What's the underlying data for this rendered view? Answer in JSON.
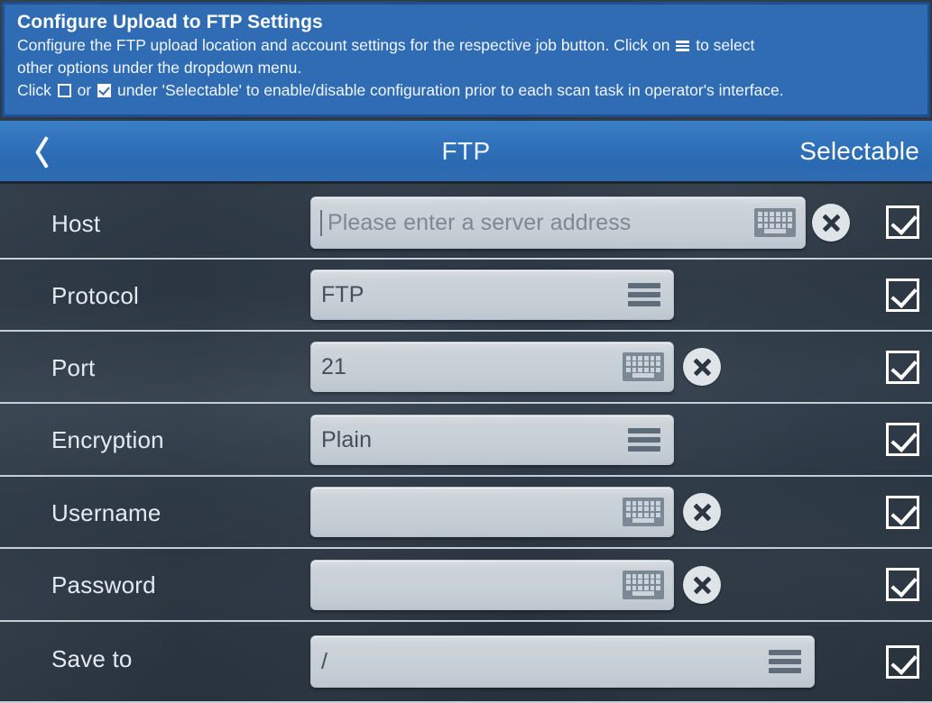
{
  "banner": {
    "title": "Configure Upload to FTP Settings",
    "line1_a": "Configure the FTP upload location and account settings for the respective job button. Click on",
    "line1_b": "to select",
    "line2": "other options under the dropdown menu.",
    "line3_a": "Click",
    "line3_b": "or",
    "line3_c": "under 'Selectable' to enable/disable configuration prior to each scan task in operator's interface.",
    "colors": {
      "background": "#2f6cb4",
      "border": "#1f4f8c",
      "text": "#ffffff"
    }
  },
  "navbar": {
    "back_icon": "chevron-left-icon",
    "title": "FTP",
    "right_label": "Selectable",
    "color": "#2f71ba"
  },
  "rows": [
    {
      "label": "Host",
      "value": "",
      "placeholder": "Please enter a server address",
      "control": "text",
      "has_caret": true,
      "icon": "keyboard-icon",
      "has_clear": true,
      "selectable_checked": true
    },
    {
      "label": "Protocol",
      "value": "FTP",
      "placeholder": "",
      "control": "dropdown",
      "has_caret": false,
      "icon": "hamburger-icon",
      "has_clear": false,
      "selectable_checked": true
    },
    {
      "label": "Port",
      "value": "21",
      "placeholder": "",
      "control": "text",
      "has_caret": false,
      "icon": "keyboard-icon",
      "has_clear": true,
      "selectable_checked": true
    },
    {
      "label": "Encryption",
      "value": "Plain",
      "placeholder": "",
      "control": "dropdown",
      "has_caret": false,
      "icon": "hamburger-icon",
      "has_clear": false,
      "selectable_checked": true
    },
    {
      "label": "Username",
      "value": "",
      "placeholder": "",
      "control": "text",
      "has_caret": false,
      "icon": "keyboard-icon",
      "has_clear": true,
      "selectable_checked": true
    },
    {
      "label": "Password",
      "value": "",
      "placeholder": "",
      "control": "text",
      "has_caret": false,
      "icon": "keyboard-icon",
      "has_clear": true,
      "selectable_checked": true
    },
    {
      "label": "Save to",
      "value": "/",
      "placeholder": "",
      "control": "dropdown",
      "has_caret": false,
      "icon": "hamburger-icon",
      "has_clear": false,
      "selectable_checked": true
    }
  ],
  "theme": {
    "body_background": "#2b3643",
    "field_background": "#c8d0d7",
    "separator": "#c3cdd6",
    "label_color": "#e3eaf1"
  }
}
